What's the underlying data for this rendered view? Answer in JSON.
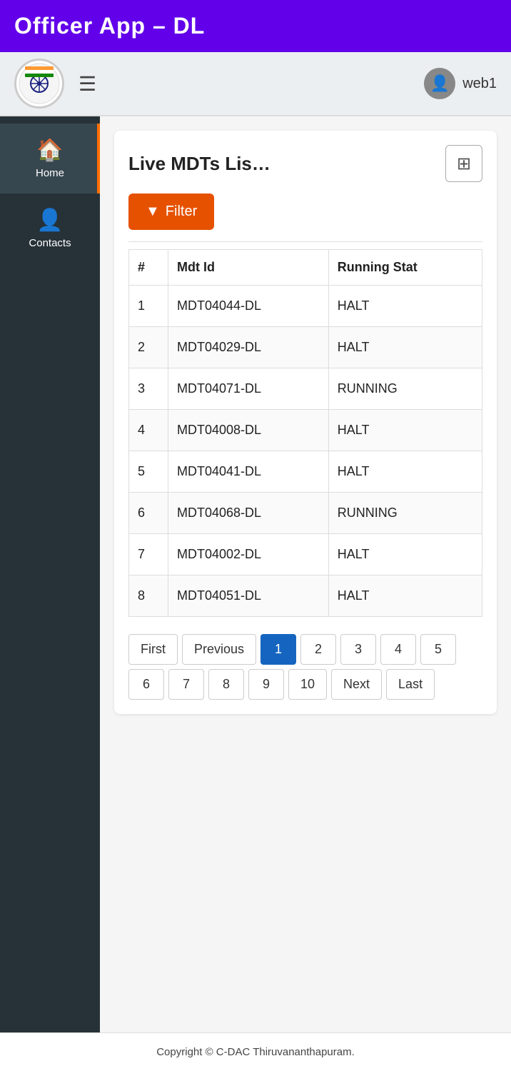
{
  "header": {
    "title": "Officer App – DL"
  },
  "nav": {
    "username": "web1",
    "hamburger_label": "☰"
  },
  "sidebar": {
    "items": [
      {
        "label": "Home",
        "icon": "🏠",
        "active": true
      },
      {
        "label": "Contacts",
        "icon": "👤",
        "active": false
      }
    ]
  },
  "card": {
    "title": "Live MDTs Lis…",
    "filter_label": "Filter",
    "grid_icon": "⊞"
  },
  "table": {
    "columns": [
      "#",
      "Mdt Id",
      "Running Stat"
    ],
    "rows": [
      {
        "num": "1",
        "mdt_id": "MDT04044-DL",
        "status": "HALT"
      },
      {
        "num": "2",
        "mdt_id": "MDT04029-DL",
        "status": "HALT"
      },
      {
        "num": "3",
        "mdt_id": "MDT04071-DL",
        "status": "RUNNING"
      },
      {
        "num": "4",
        "mdt_id": "MDT04008-DL",
        "status": "HALT"
      },
      {
        "num": "5",
        "mdt_id": "MDT04041-DL",
        "status": "HALT"
      },
      {
        "num": "6",
        "mdt_id": "MDT04068-DL",
        "status": "RUNNING"
      },
      {
        "num": "7",
        "mdt_id": "MDT04002-DL",
        "status": "HALT"
      },
      {
        "num": "8",
        "mdt_id": "MDT04051-DL",
        "status": "HALT"
      }
    ]
  },
  "pagination": {
    "pages": [
      "First",
      "Previous",
      "1",
      "2",
      "3",
      "4",
      "5",
      "6",
      "7",
      "8",
      "9",
      "10",
      "Next",
      "Last"
    ],
    "active_page": "1"
  },
  "footer": {
    "text": "Copyright © C-DAC Thiruvananthapuram."
  }
}
